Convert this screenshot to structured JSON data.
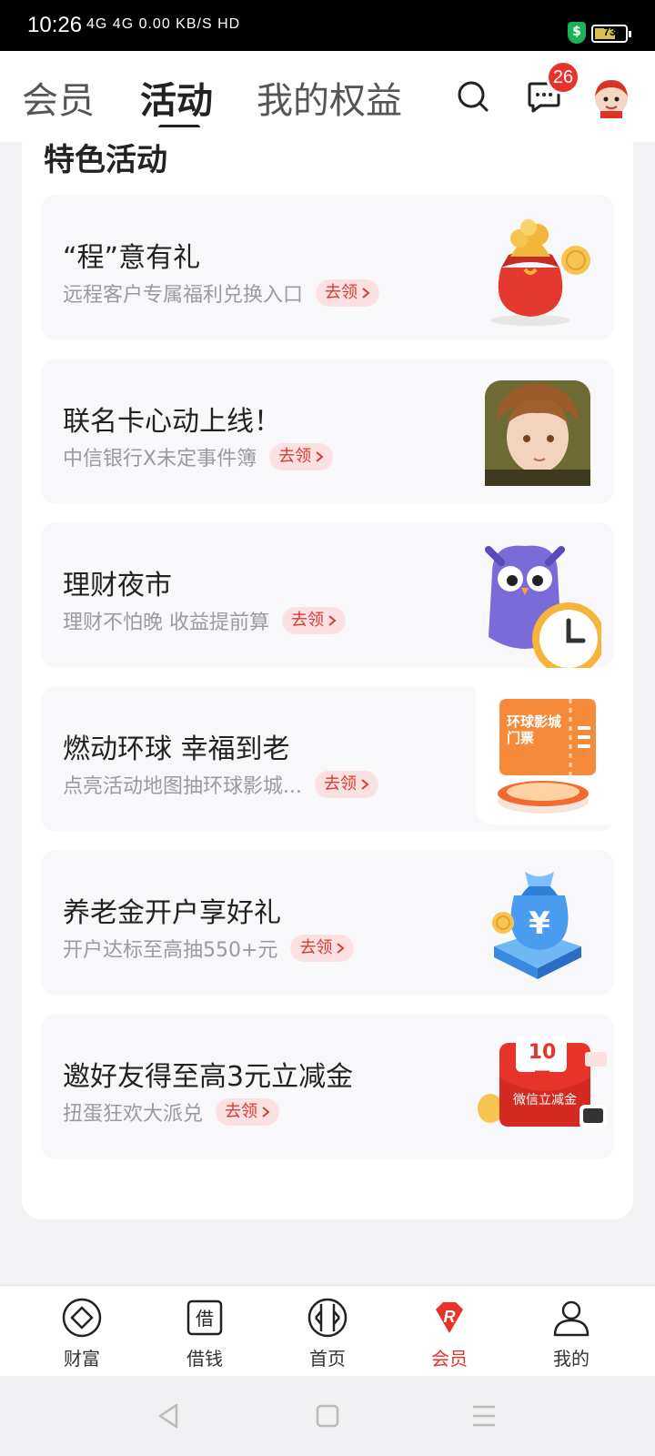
{
  "status_bar": {
    "time": "10:26",
    "network": "4G 4G 0.00 KB/S HD",
    "battery": "73",
    "shield_icon": "shield-dollar-icon"
  },
  "header": {
    "tabs": [
      {
        "label": "会员"
      },
      {
        "label": "活动"
      },
      {
        "label": "我的权益"
      }
    ],
    "active_tab": "活动",
    "message_badge": "26",
    "icons": [
      "search-icon",
      "message-icon",
      "avatar-icon"
    ]
  },
  "section": {
    "title": "特色活动"
  },
  "activities": [
    {
      "title": "“程”意有礼",
      "subtitle": "远程客户专属福利兑换入口",
      "button": "去领",
      "image": "money-bag-icon"
    },
    {
      "title": "联名卡心动上线！",
      "subtitle": "中信银行X未定事件簿",
      "button": "去领",
      "image": "anime-character-icon"
    },
    {
      "title": "理财夜市",
      "subtitle": "理财不怕晚 收益提前算",
      "button": "去领",
      "image": "owl-clock-icon"
    },
    {
      "title": "燃动环球 幸福到老",
      "subtitle": "点亮活动地图抽环球影城...",
      "button": "去领",
      "image": "ticket-icon",
      "image_text": "环球影城 门票"
    },
    {
      "title": "养老金开户享好礼",
      "subtitle": "开户达标至高抽550+元",
      "button": "去领",
      "image": "yuan-bag-icon"
    },
    {
      "title": "邀好友得至高3元立减金",
      "subtitle": "扭蛋狂欢大派兑",
      "button": "去领",
      "image": "red-envelope-icon",
      "image_text_amount": "10元",
      "image_text_label": "微信立减金"
    }
  ],
  "bottom_nav": [
    {
      "label": "财富",
      "icon": "wealth-icon",
      "active": false
    },
    {
      "label": "借钱",
      "icon": "loan-icon",
      "active": false
    },
    {
      "label": "首页",
      "icon": "home-icon",
      "active": false
    },
    {
      "label": "会员",
      "icon": "member-icon",
      "active": true
    },
    {
      "label": "我的",
      "icon": "profile-icon",
      "active": false
    }
  ],
  "colors": {
    "accent": "#e8332b",
    "button_bg": "#fbe1e1",
    "card_bg": "#f8f8fa"
  }
}
